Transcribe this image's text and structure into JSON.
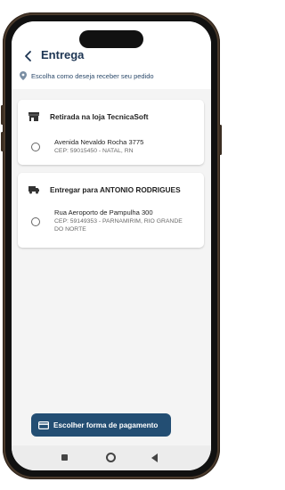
{
  "header": {
    "title": "Entrega",
    "subtitle": "Escolha como deseja receber seu pedido"
  },
  "pickup": {
    "label": "Retirada na loja TecnicaSoft",
    "street": "Avenida Nevaldo Rocha 3775",
    "cep": "CEP: 59015450 - NATAL, RN"
  },
  "delivery": {
    "label": "Entregar para ANTONIO RODRIGUES",
    "street": "Rua Aeroporto de Pampulha 300",
    "cep": "CEP: 59149353 - PARNAMIRIM, RIO GRANDE DO NORTE"
  },
  "footer": {
    "pay_label": "Escolher forma de pagamento"
  },
  "colors": {
    "primary": "#234e73",
    "title": "#1d3553"
  }
}
